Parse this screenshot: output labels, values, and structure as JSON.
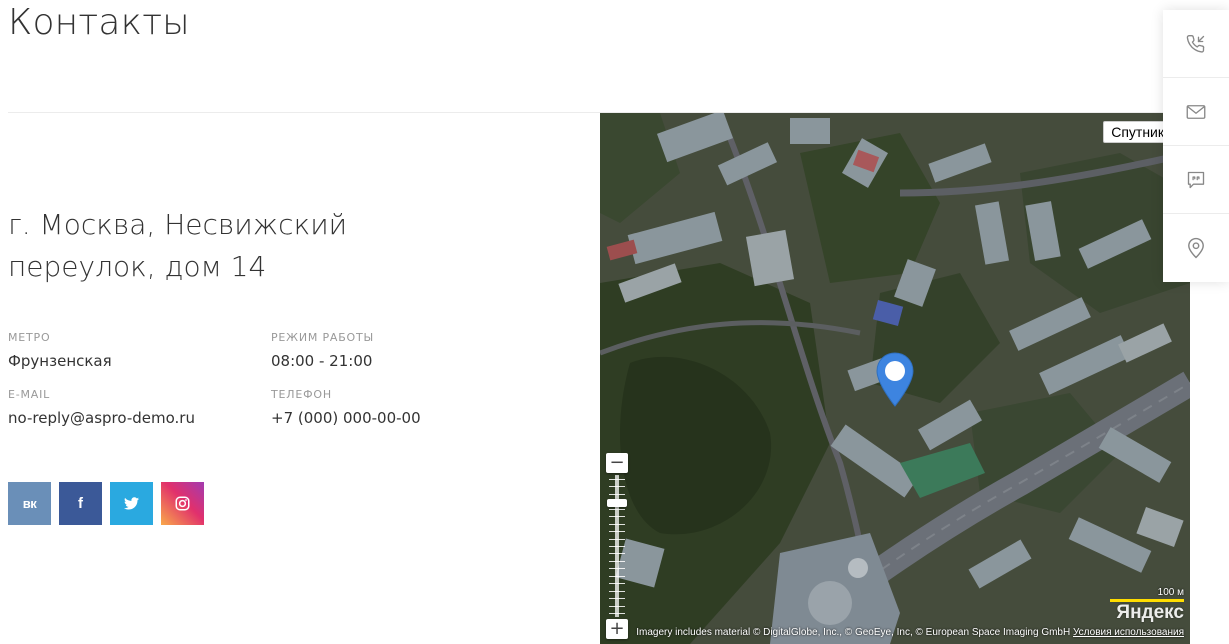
{
  "page": {
    "title": "Контакты"
  },
  "contact": {
    "address": "г. Москва, Несвижский переулок, дом 14",
    "metro_label": "МЕТРО",
    "metro_value": "Фрунзенская",
    "hours_label": "РЕЖИМ РАБОТЫ",
    "hours_value": "08:00 - 21:00",
    "email_label": "E-MAIL",
    "email_value": "no-reply@aspro-demo.ru",
    "phone_label": "ТЕЛЕФОН",
    "phone_value": "+7 (000) 000-00-00"
  },
  "socials": [
    {
      "name": "vk",
      "label": "вк",
      "color": "#6a8fb8",
      "icon": "vk-icon"
    },
    {
      "name": "facebook",
      "label": "f",
      "color": "#3b5998",
      "icon": "facebook-icon"
    },
    {
      "name": "twitter",
      "label": "",
      "color": "#2aa9e0",
      "icon": "twitter-icon"
    },
    {
      "name": "instagram",
      "label": "",
      "color": "#c13584",
      "icon": "instagram-icon"
    }
  ],
  "map": {
    "type_button": "Спутник",
    "scale_label": "100 м",
    "logo": "Яндекс",
    "copyright": "Imagery includes material © DigitalGlobe, Inc., © GeoEye, Inc, © European Space Imaging GmbH",
    "terms_link": "Условия использования",
    "zoom_in": "+",
    "zoom_out": "−",
    "zoom_level_fraction": 0.82,
    "pin_color": "#3d84e0"
  },
  "side_panel": [
    {
      "name": "callback",
      "icon": "phone-incoming-icon"
    },
    {
      "name": "email",
      "icon": "envelope-icon"
    },
    {
      "name": "feedback",
      "icon": "quote-bubble-icon"
    },
    {
      "name": "location",
      "icon": "map-pin-icon"
    }
  ]
}
